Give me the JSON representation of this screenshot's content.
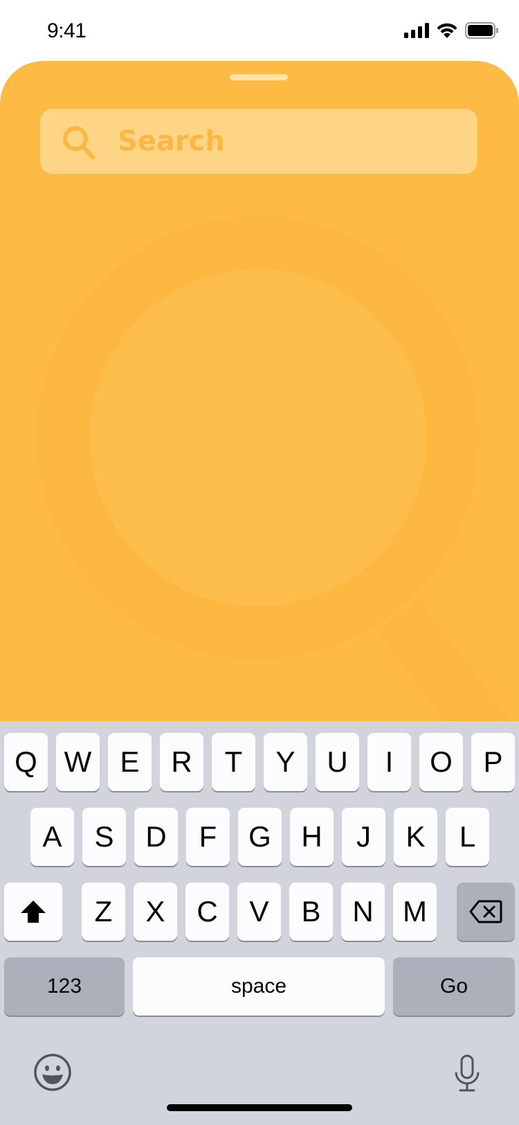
{
  "status_bar": {
    "time": "9:41",
    "icons": [
      "cellular-signal-icon",
      "wifi-icon",
      "battery-icon"
    ]
  },
  "colors": {
    "sheet": "#FDBB46",
    "search_bar": "#FED485",
    "search_accent": "#FCB644",
    "keyboard_bg": "#D1D4DC",
    "key": "#FCFCFE",
    "key_dark": "#ABB0BA"
  },
  "search": {
    "placeholder": "Search",
    "icon": "search-icon"
  },
  "illustration": {
    "icon": "magnifying-glass-illustration"
  },
  "keyboard": {
    "row1": [
      "Q",
      "W",
      "E",
      "R",
      "T",
      "Y",
      "U",
      "I",
      "O",
      "P"
    ],
    "row2": [
      "A",
      "S",
      "D",
      "F",
      "G",
      "H",
      "J",
      "K",
      "L"
    ],
    "row3": [
      "Z",
      "X",
      "C",
      "V",
      "B",
      "N",
      "M"
    ],
    "shift_icon": "shift-icon",
    "delete_icon": "delete-icon",
    "numbers_label": "123",
    "space_label": "space",
    "go_label": "Go",
    "emoji_icon": "emoji-icon",
    "mic_icon": "microphone-icon"
  }
}
